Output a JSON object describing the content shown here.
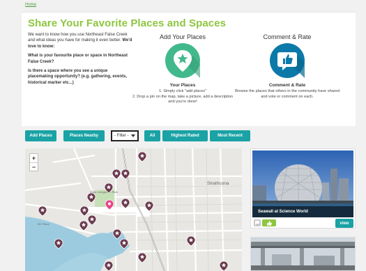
{
  "breadcrumb": "Home",
  "hero": {
    "title": "Share Your Favorite Places and Spaces",
    "intro_lead": "We want to know how you use Northeast False Creek and what ideas you have for making it even better.",
    "intro_strong": "We'd love to know:",
    "question1": "What is your favourite place or space in Northeast False Creek?",
    "question2": "Is there a space where you see a unique placemaking opportunity? (e.g. gathering, events, historical marker etc...)"
  },
  "add_places": {
    "heading": "Add Your Places",
    "subheading": "Your Places",
    "step1": "1. Simply click \"add places\"",
    "step2": "2. Drop a pin on the map, take a picture, add a description and you're done!"
  },
  "comment_rate": {
    "heading": "Comment & Rate",
    "subheading": "Comment & Rate",
    "text": "Browse the places that others in the community have shared and vote or comment on each."
  },
  "toolbar": {
    "add_places": "Add Places",
    "places_nearby": "Places Nearby",
    "filter": "- Filter -",
    "all": "All",
    "highest_rated": "Highest Rated",
    "most_recent": "Most Recent"
  },
  "map": {
    "zoom_in": "+",
    "zoom_out": "−",
    "label_strathcona": "Strathcona",
    "label_park": "Andy Livingstone Park",
    "label_bc_place": "BC Place"
  },
  "card": {
    "caption": "Seawall at Science World",
    "view": "view"
  },
  "colors": {
    "accent": "#1aa2a5",
    "title_green": "#8dc63f",
    "badge_green": "#42b98d",
    "badge_blue": "#0c7aa9",
    "pin": "#6b3a4f",
    "pin_selected": "#e8458b"
  },
  "icons": [
    "star-pin-icon",
    "thumbs-up-bubble-icon",
    "map-pin-icon",
    "star-pin-selected-icon",
    "chevron-down-icon"
  ]
}
